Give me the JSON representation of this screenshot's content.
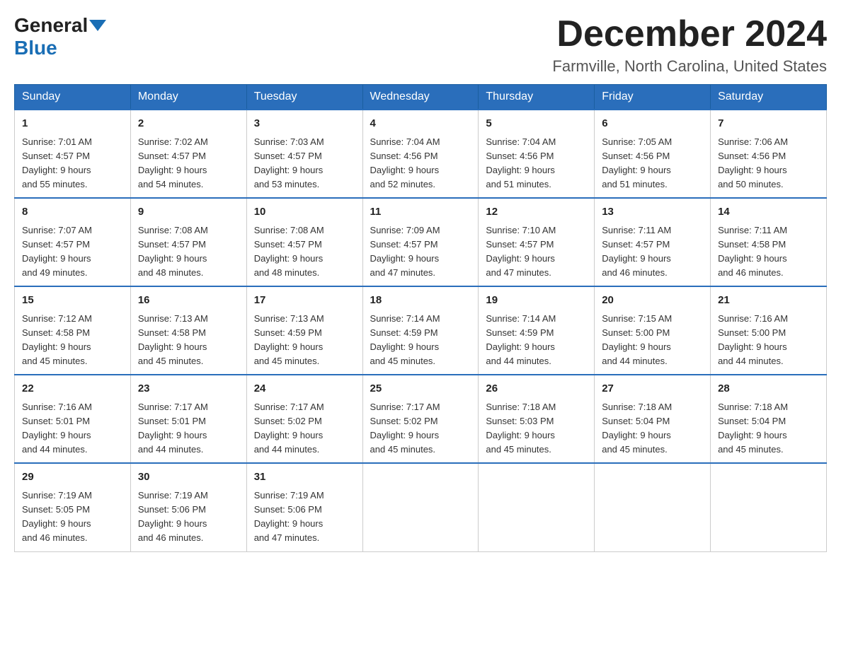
{
  "header": {
    "logo_general": "General",
    "logo_blue": "Blue",
    "month_title": "December 2024",
    "location": "Farmville, North Carolina, United States"
  },
  "weekdays": [
    "Sunday",
    "Monday",
    "Tuesday",
    "Wednesday",
    "Thursday",
    "Friday",
    "Saturday"
  ],
  "weeks": [
    [
      {
        "day": "1",
        "sunrise": "7:01 AM",
        "sunset": "4:57 PM",
        "daylight": "9 hours and 55 minutes."
      },
      {
        "day": "2",
        "sunrise": "7:02 AM",
        "sunset": "4:57 PM",
        "daylight": "9 hours and 54 minutes."
      },
      {
        "day": "3",
        "sunrise": "7:03 AM",
        "sunset": "4:57 PM",
        "daylight": "9 hours and 53 minutes."
      },
      {
        "day": "4",
        "sunrise": "7:04 AM",
        "sunset": "4:56 PM",
        "daylight": "9 hours and 52 minutes."
      },
      {
        "day": "5",
        "sunrise": "7:04 AM",
        "sunset": "4:56 PM",
        "daylight": "9 hours and 51 minutes."
      },
      {
        "day": "6",
        "sunrise": "7:05 AM",
        "sunset": "4:56 PM",
        "daylight": "9 hours and 51 minutes."
      },
      {
        "day": "7",
        "sunrise": "7:06 AM",
        "sunset": "4:56 PM",
        "daylight": "9 hours and 50 minutes."
      }
    ],
    [
      {
        "day": "8",
        "sunrise": "7:07 AM",
        "sunset": "4:57 PM",
        "daylight": "9 hours and 49 minutes."
      },
      {
        "day": "9",
        "sunrise": "7:08 AM",
        "sunset": "4:57 PM",
        "daylight": "9 hours and 48 minutes."
      },
      {
        "day": "10",
        "sunrise": "7:08 AM",
        "sunset": "4:57 PM",
        "daylight": "9 hours and 48 minutes."
      },
      {
        "day": "11",
        "sunrise": "7:09 AM",
        "sunset": "4:57 PM",
        "daylight": "9 hours and 47 minutes."
      },
      {
        "day": "12",
        "sunrise": "7:10 AM",
        "sunset": "4:57 PM",
        "daylight": "9 hours and 47 minutes."
      },
      {
        "day": "13",
        "sunrise": "7:11 AM",
        "sunset": "4:57 PM",
        "daylight": "9 hours and 46 minutes."
      },
      {
        "day": "14",
        "sunrise": "7:11 AM",
        "sunset": "4:58 PM",
        "daylight": "9 hours and 46 minutes."
      }
    ],
    [
      {
        "day": "15",
        "sunrise": "7:12 AM",
        "sunset": "4:58 PM",
        "daylight": "9 hours and 45 minutes."
      },
      {
        "day": "16",
        "sunrise": "7:13 AM",
        "sunset": "4:58 PM",
        "daylight": "9 hours and 45 minutes."
      },
      {
        "day": "17",
        "sunrise": "7:13 AM",
        "sunset": "4:59 PM",
        "daylight": "9 hours and 45 minutes."
      },
      {
        "day": "18",
        "sunrise": "7:14 AM",
        "sunset": "4:59 PM",
        "daylight": "9 hours and 45 minutes."
      },
      {
        "day": "19",
        "sunrise": "7:14 AM",
        "sunset": "4:59 PM",
        "daylight": "9 hours and 44 minutes."
      },
      {
        "day": "20",
        "sunrise": "7:15 AM",
        "sunset": "5:00 PM",
        "daylight": "9 hours and 44 minutes."
      },
      {
        "day": "21",
        "sunrise": "7:16 AM",
        "sunset": "5:00 PM",
        "daylight": "9 hours and 44 minutes."
      }
    ],
    [
      {
        "day": "22",
        "sunrise": "7:16 AM",
        "sunset": "5:01 PM",
        "daylight": "9 hours and 44 minutes."
      },
      {
        "day": "23",
        "sunrise": "7:17 AM",
        "sunset": "5:01 PM",
        "daylight": "9 hours and 44 minutes."
      },
      {
        "day": "24",
        "sunrise": "7:17 AM",
        "sunset": "5:02 PM",
        "daylight": "9 hours and 44 minutes."
      },
      {
        "day": "25",
        "sunrise": "7:17 AM",
        "sunset": "5:02 PM",
        "daylight": "9 hours and 45 minutes."
      },
      {
        "day": "26",
        "sunrise": "7:18 AM",
        "sunset": "5:03 PM",
        "daylight": "9 hours and 45 minutes."
      },
      {
        "day": "27",
        "sunrise": "7:18 AM",
        "sunset": "5:04 PM",
        "daylight": "9 hours and 45 minutes."
      },
      {
        "day": "28",
        "sunrise": "7:18 AM",
        "sunset": "5:04 PM",
        "daylight": "9 hours and 45 minutes."
      }
    ],
    [
      {
        "day": "29",
        "sunrise": "7:19 AM",
        "sunset": "5:05 PM",
        "daylight": "9 hours and 46 minutes."
      },
      {
        "day": "30",
        "sunrise": "7:19 AM",
        "sunset": "5:06 PM",
        "daylight": "9 hours and 46 minutes."
      },
      {
        "day": "31",
        "sunrise": "7:19 AM",
        "sunset": "5:06 PM",
        "daylight": "9 hours and 47 minutes."
      },
      null,
      null,
      null,
      null
    ]
  ],
  "labels": {
    "sunrise": "Sunrise:",
    "sunset": "Sunset:",
    "daylight": "Daylight:"
  }
}
